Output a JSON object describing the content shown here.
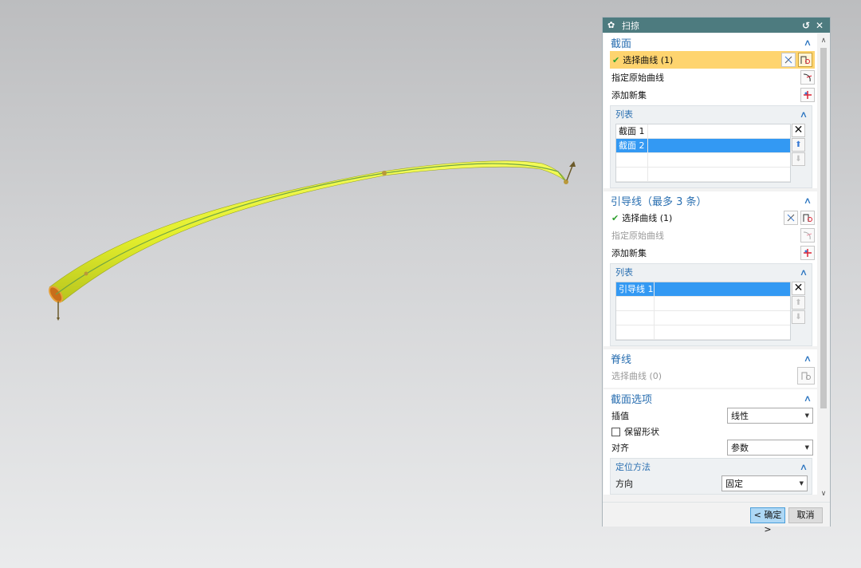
{
  "dialog": {
    "title": "扫掠",
    "reset_icon": "reset-icon",
    "close_icon": "close-icon",
    "sections": {
      "section": {
        "title": "截面",
        "select_curve": "选择曲线 (1)",
        "specify_original": "指定原始曲线",
        "add_new_set": "添加新集",
        "list_title": "列表",
        "items": [
          "截面 1",
          "截面 2"
        ],
        "selected_index": 1
      },
      "guide": {
        "title": "引导线（最多 3 条）",
        "select_curve": "选择曲线 (1)",
        "specify_original": "指定原始曲线",
        "add_new_set": "添加新集",
        "list_title": "列表",
        "items": [
          "引导线 1"
        ],
        "selected_index": 0
      },
      "spine": {
        "title": "脊线",
        "select_curve": "选择曲线 (0)"
      },
      "section_options": {
        "title": "截面选项",
        "interpolation_label": "插值",
        "interpolation_value": "线性",
        "keep_shape_label": "保留形状",
        "keep_shape_checked": false,
        "alignment_label": "对齐",
        "alignment_value": "参数",
        "positioning_title": "定位方法",
        "orientation_label": "方向",
        "orientation_value": "固定"
      }
    },
    "ok_label": "< 确定 >",
    "cancel_label": "取消"
  },
  "colors": {
    "titlebar": "#4d7b7f",
    "accent_blue": "#2a6fb1",
    "selection_highlight": "#fed46f",
    "list_selection": "#3399f3",
    "sweep_body": "#e8f23a",
    "guide_curve": "#6fa344"
  }
}
